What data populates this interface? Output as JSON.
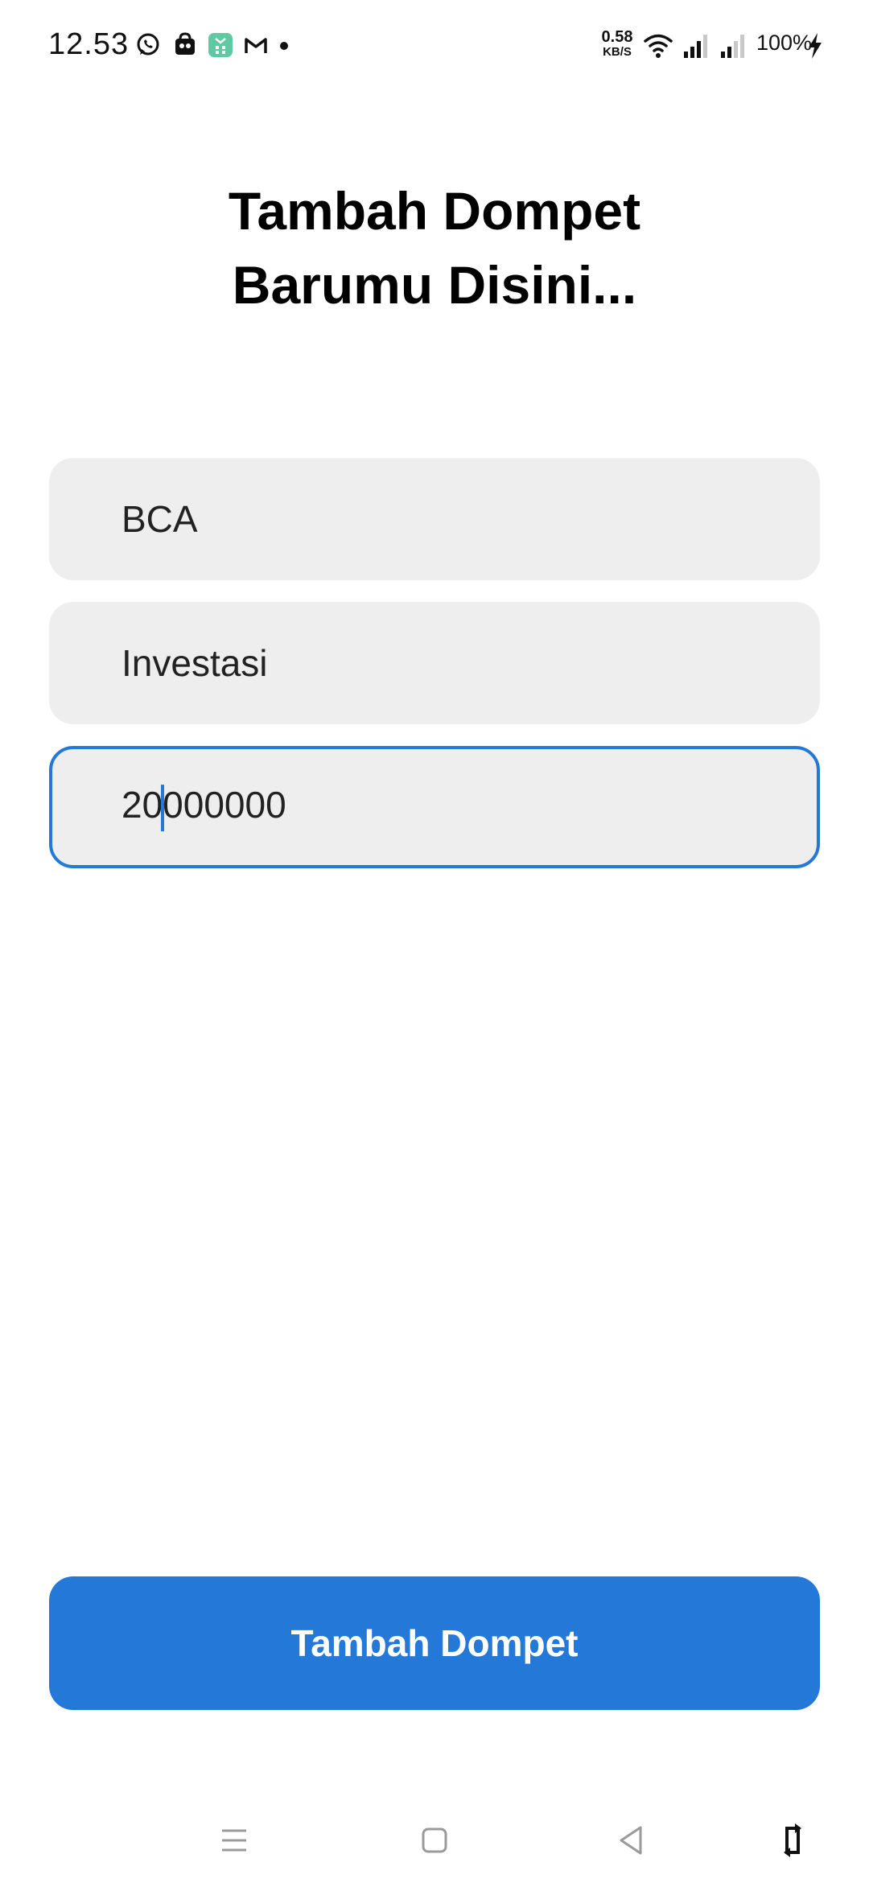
{
  "status_bar": {
    "time": "12.53",
    "notification_icons": [
      "whatsapp-icon",
      "shop-bag-icon",
      "green-app-icon",
      "gmail-icon",
      "more-dot-icon"
    ],
    "speed_value": "0.58",
    "speed_unit": "KB/S",
    "battery": "100%",
    "icons": [
      "wifi-icon",
      "signal-icon",
      "signal-icon",
      "charging-icon"
    ]
  },
  "page": {
    "title_line1": "Tambah Dompet",
    "title_line2": "Barumu Disini..."
  },
  "form": {
    "wallet_name_value": "BCA",
    "wallet_type_value": "Investasi",
    "balance_value_before_caret": "20",
    "balance_value_after_caret": "000000"
  },
  "actions": {
    "submit_label": "Tambah Dompet"
  },
  "colors": {
    "accent": "#2378d8",
    "field_bg": "#eeeeee"
  },
  "navigation": {
    "icons": [
      "menu-icon",
      "home-icon",
      "back-icon",
      "rotate-icon"
    ]
  }
}
